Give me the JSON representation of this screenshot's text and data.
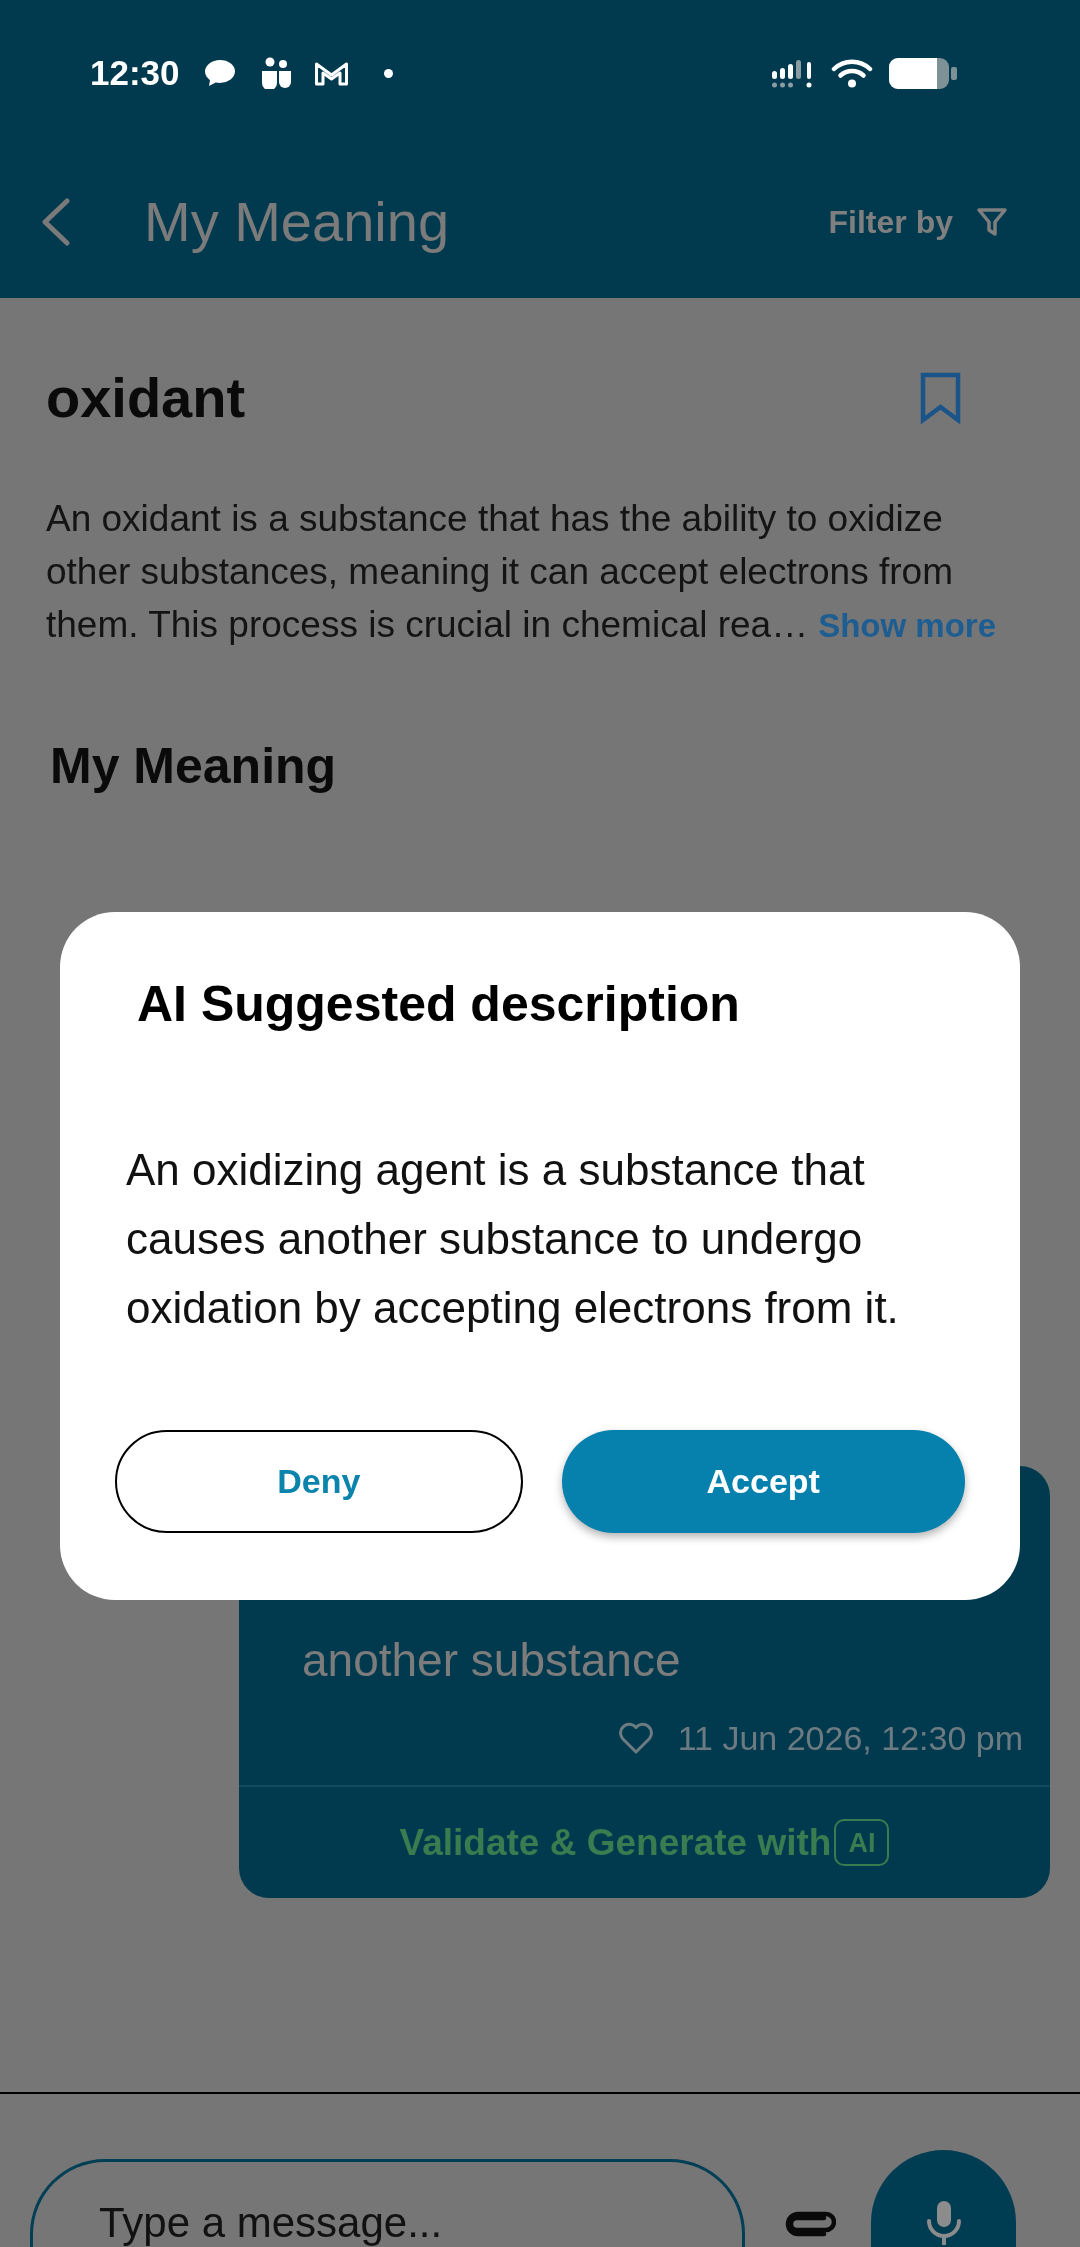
{
  "status_bar": {
    "time": "12:30"
  },
  "app_bar": {
    "title": "My Meaning",
    "filter_label": "Filter by"
  },
  "word": {
    "term": "oxidant",
    "bookmarked": false,
    "description": "An oxidant is a substance that has the ability to oxidize other substances, meaning it can accept electrons from them. This process is crucial in chemical rea…",
    "show_more": "Show more"
  },
  "section_title": "My Meaning",
  "meaning_card": {
    "text": "another substance",
    "liked": false,
    "timestamp": "11 Jun 2026, 12:30 pm",
    "action": "Validate & Generate with",
    "badge": "AI"
  },
  "dialog": {
    "title": "AI Suggested description",
    "body": "An oxidizing agent is a substance that causes another substance to undergo oxidation by accepting electrons from it.",
    "buttons": [
      {
        "label": "Deny",
        "kind": "outline"
      },
      {
        "label": "Accept",
        "kind": "filled"
      }
    ]
  },
  "composer": {
    "placeholder": "Type a message..."
  }
}
